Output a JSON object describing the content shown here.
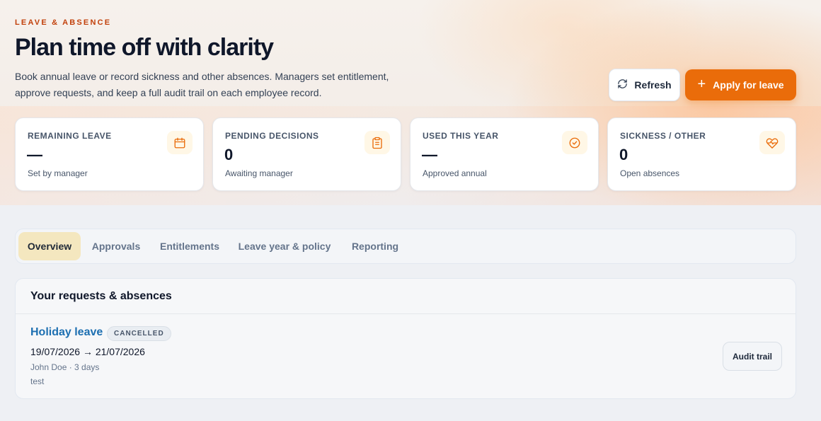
{
  "header": {
    "eyebrow": "LEAVE & ABSENCE",
    "title": "Plan time off with clarity",
    "subtitle": "Book annual leave or record sickness and other absences. Managers set entitlement, approve requests, and keep a full audit trail on each employee record."
  },
  "actions": {
    "refresh_label": "Refresh",
    "apply_label": "Apply for leave"
  },
  "stats": [
    {
      "label": "REMAINING LEAVE",
      "value": "—",
      "sub": "Set by manager",
      "icon": "calendar-icon"
    },
    {
      "label": "PENDING DECISIONS",
      "value": "0",
      "sub": "Awaiting manager",
      "icon": "clipboard-icon"
    },
    {
      "label": "USED THIS YEAR",
      "value": "—",
      "sub": "Approved annual",
      "icon": "check-circle-icon"
    },
    {
      "label": "SICKNESS / OTHER",
      "value": "0",
      "sub": "Open absences",
      "icon": "heart-pulse-icon"
    }
  ],
  "tabs": [
    {
      "label": "Overview",
      "active": true
    },
    {
      "label": "Approvals",
      "active": false
    },
    {
      "label": "Entitlements",
      "active": false
    },
    {
      "label": "Leave year & policy",
      "active": false
    },
    {
      "label": "Reporting",
      "active": false
    }
  ],
  "requests": {
    "heading": "Your requests & absences",
    "items": [
      {
        "title": "Holiday leave",
        "status": "CANCELLED",
        "dates": "19/07/2026 → 21/07/2026",
        "meta": "John Doe · 3 days",
        "note": "test",
        "audit_label": "Audit trail"
      }
    ]
  },
  "colors": {
    "accent": "#ea6c0a",
    "eyebrow": "#c2410c",
    "link": "#1d6fb1",
    "active_tab": "#f4e7bf",
    "icon_tint": "#fff7e6"
  }
}
